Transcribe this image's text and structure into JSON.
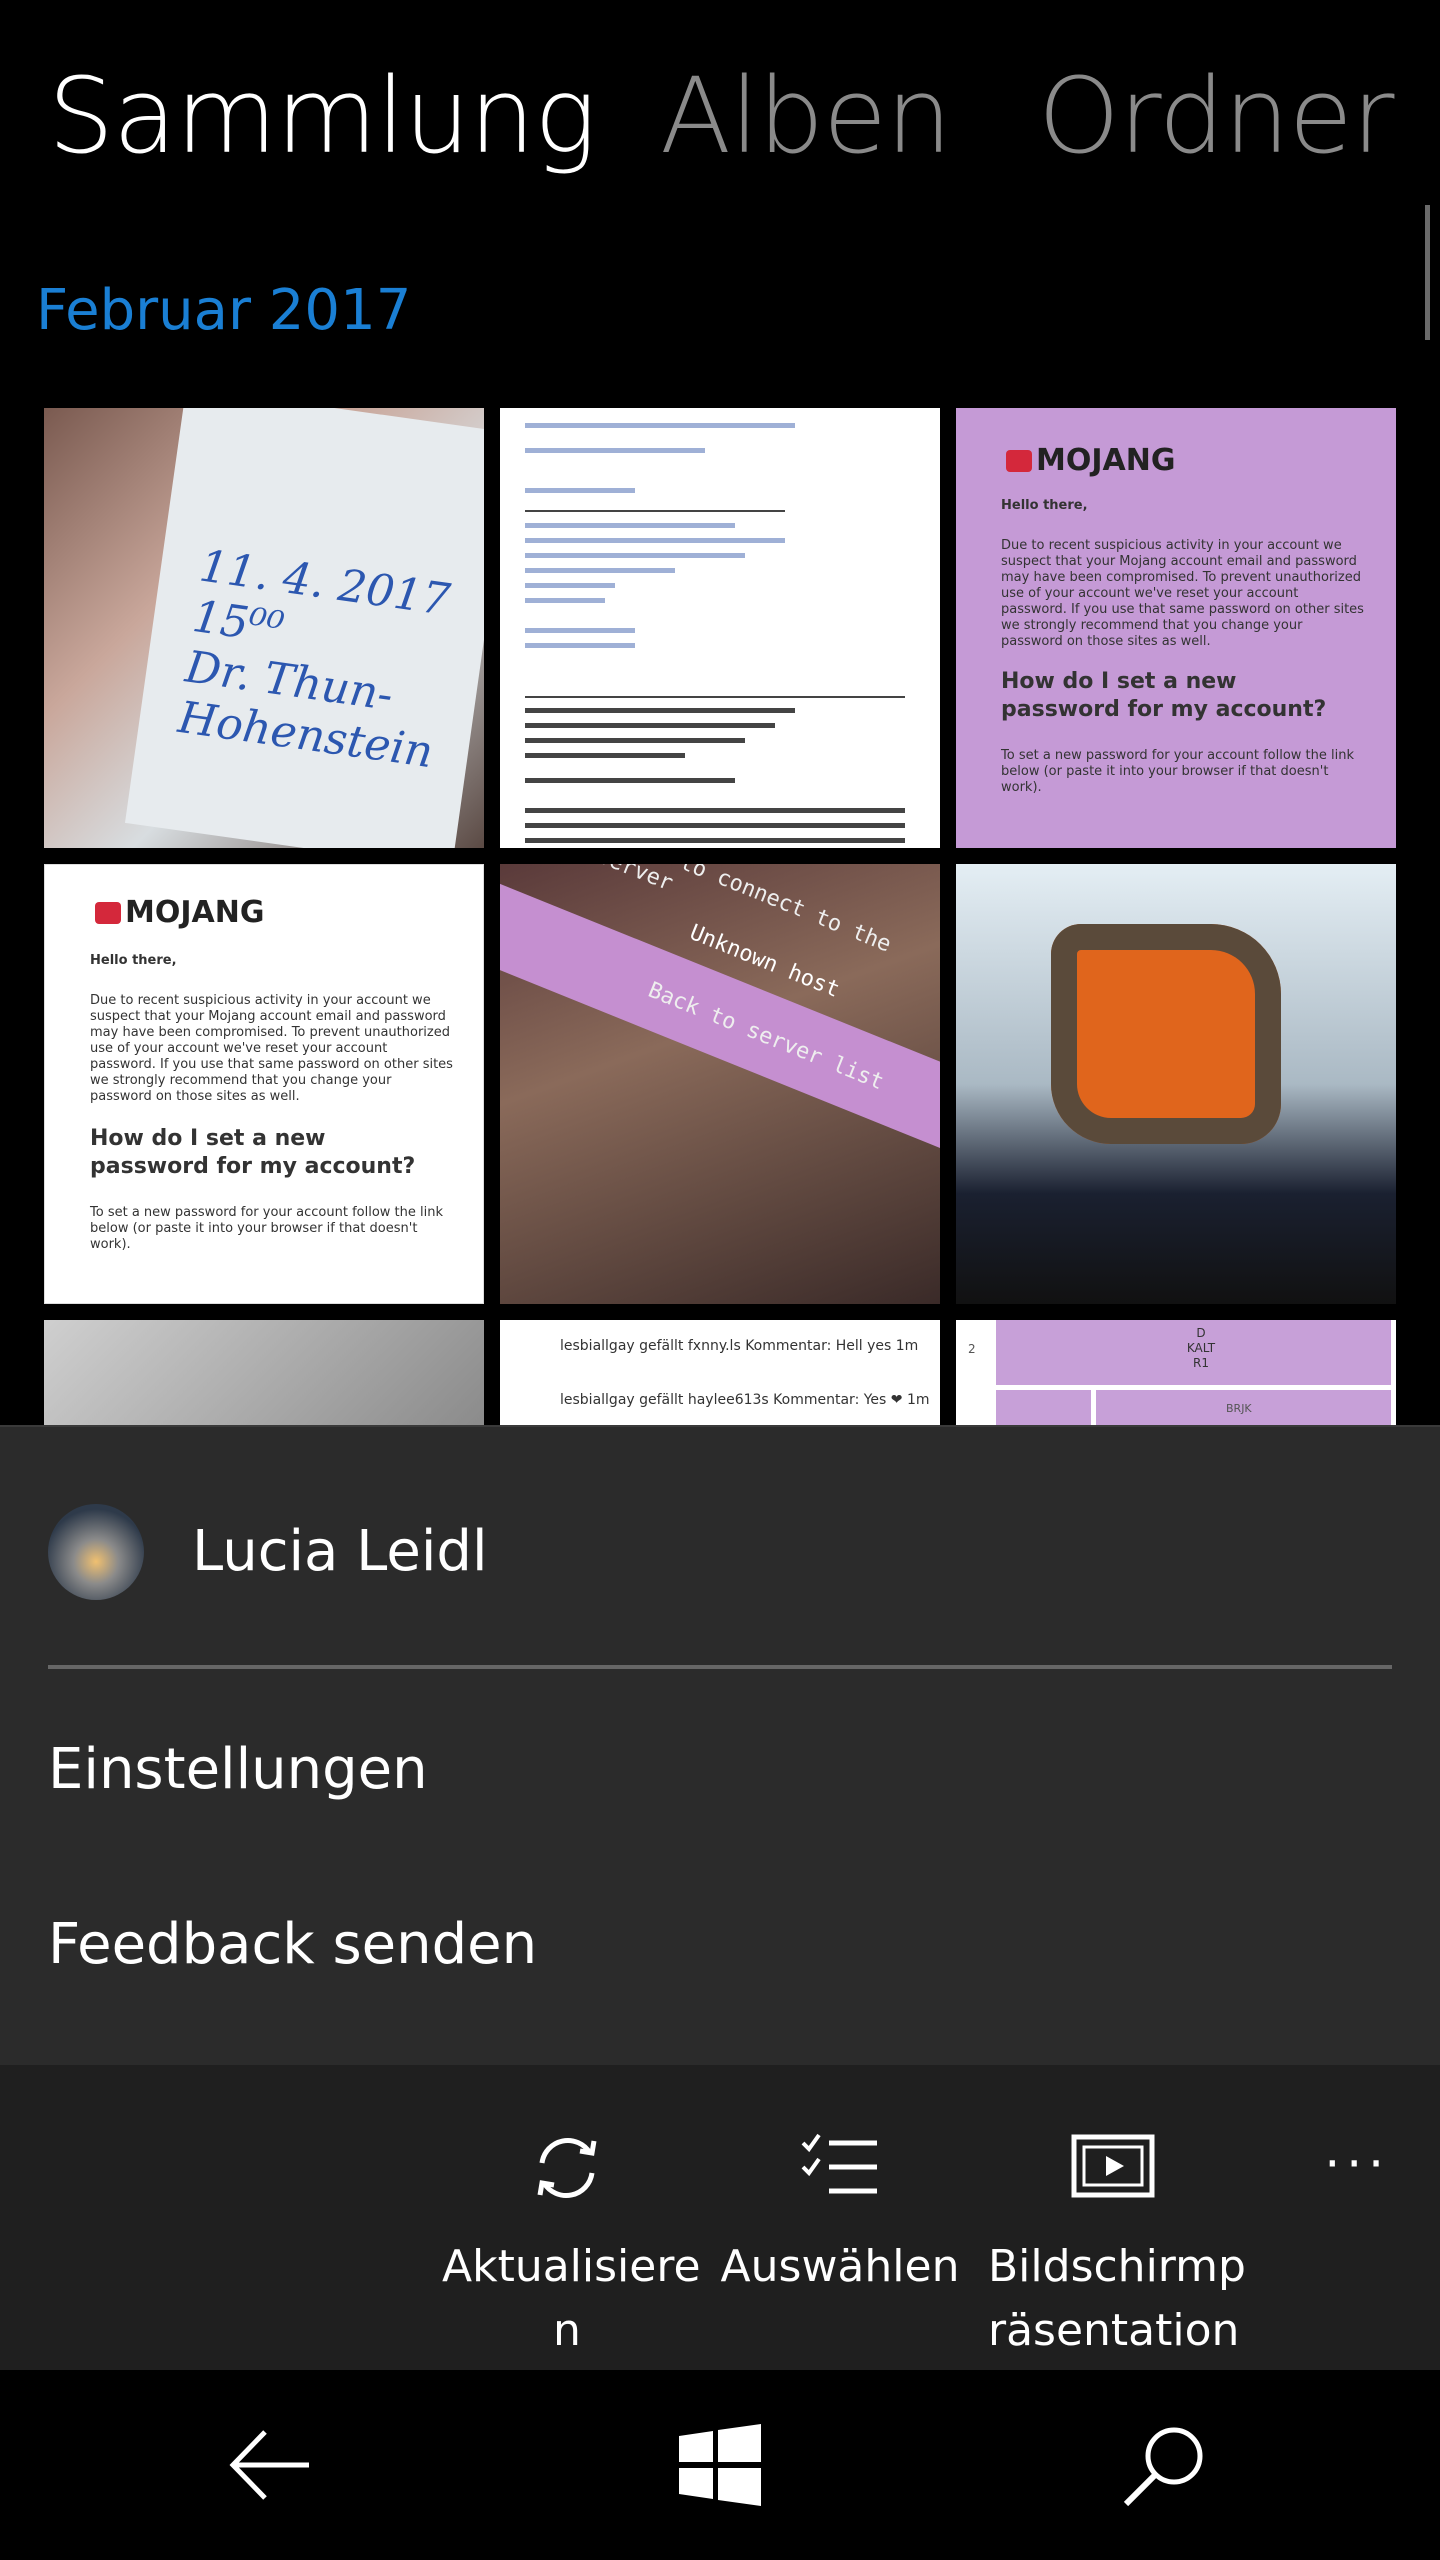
{
  "pivot": {
    "tabs": [
      "Sammlung",
      "Alben",
      "Ordner"
    ],
    "active": 0
  },
  "section": {
    "month": "Februar 2017"
  },
  "photos": {
    "hand_note": {
      "line1": "11. 4. 2017 15⁰⁰",
      "line2": "Dr. Thun-Hohenstein"
    },
    "mojang_logo": "MOJANG",
    "mojang_greeting": "Hello there,",
    "mojang_body": "Due to recent suspicious activity in your account we suspect that your Mojang account email and password may have been compromised. To prevent unauthorized use of your account we've reset your account password. If you use that same password on other sites we strongly recommend that you change your password on those sites as well.",
    "mojang_heading": "How do I set a new password for my account?",
    "mojang_howto": "To set a new password for your account follow the link below (or paste it into your browser if that doesn't work).",
    "screen_text_1": "ailed to connect to the server",
    "screen_text_2": "Unknown host",
    "screen_text_3": "Back to server list",
    "insta_row_1": "lesbiallgay gefällt fxnny.ls Kommentar: Hell yes 1m",
    "insta_row_2": "lesbiallgay gefällt haylee613s Kommentar: Yes ❤ 1m",
    "table_cell_1": "D",
    "table_cell_2": "KALT",
    "table_cell_3": "R1",
    "table_cell_4": "BRJK",
    "table_row_num": "2"
  },
  "menu": {
    "user_name": "Lucia Leidl",
    "items": [
      "Einstellungen",
      "Feedback senden"
    ]
  },
  "appbar": {
    "buttons": [
      {
        "label": "Aktualisiere\nn",
        "icon": "refresh-icon"
      },
      {
        "label": "Auswählen",
        "icon": "select-list-icon"
      },
      {
        "label": "Bildschirmp\nräsentation",
        "icon": "slideshow-icon"
      }
    ],
    "more": "···"
  },
  "navbar": {
    "icons": [
      "back-arrow-icon",
      "windows-start-icon",
      "search-icon"
    ]
  }
}
